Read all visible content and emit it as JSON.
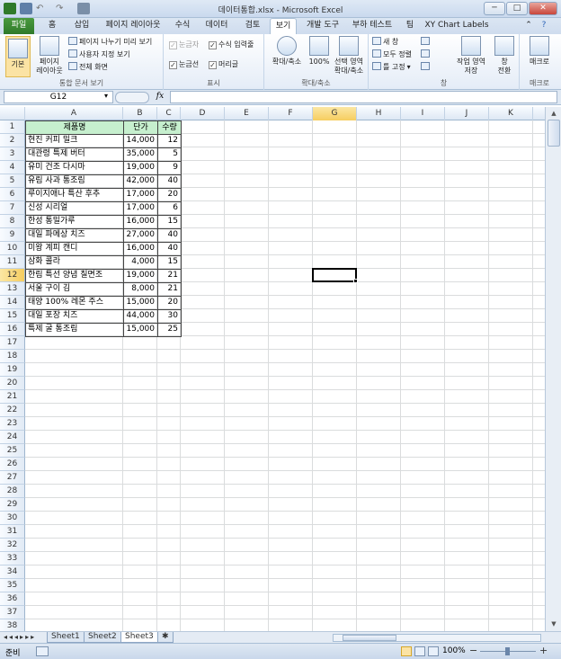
{
  "window": {
    "title": "데이터통합.xlsx - Microsoft Excel",
    "min_label": "─",
    "max_label": "□",
    "close_label": "✕"
  },
  "tabs": [
    "파일",
    "홈",
    "삽입",
    "페이지 레이아웃",
    "수식",
    "데이터",
    "검토",
    "보기",
    "개발 도구",
    "부하 테스트",
    "팀",
    "XY Chart Labels"
  ],
  "active_tab": "보기",
  "ribbon": {
    "group_workbook_views": {
      "label": "통합 문서 보기",
      "normal": "기본",
      "page_layout_1": "페이지",
      "page_layout_2": "레이아웃",
      "page_break_preview": "페이지 나누기 미리 보기",
      "custom_views": "사용자 지정 보기",
      "full_screen": "전체 화면"
    },
    "group_show": {
      "label": "표시",
      "ruler": "눈금자",
      "formula_bar": "수식 입력줄",
      "gridlines": "눈금선",
      "headings": "머리글"
    },
    "group_zoom": {
      "label": "확대/축소",
      "zoom": "확대/축소",
      "zoom100": "100%",
      "zoom_sel_1": "선택 영역",
      "zoom_sel_2": "확대/축소"
    },
    "group_window": {
      "label": "창",
      "new_window": "새 창",
      "arrange_all": "모두 정렬",
      "freeze_panes": "틀 고정",
      "save_ws_1": "작업 영역",
      "save_ws_2": "저장",
      "switch_1": "창",
      "switch_2": "전환"
    },
    "group_macros": {
      "label": "매크로",
      "macros": "매크로"
    }
  },
  "formula_bar": {
    "name_box": "G12",
    "fx": "fx",
    "value": ""
  },
  "columns": [
    "A",
    "B",
    "C",
    "D",
    "E",
    "F",
    "G",
    "H",
    "I",
    "J",
    "K"
  ],
  "selected_column": "G",
  "selected_row": 12,
  "rows": [
    "1",
    "2",
    "3",
    "4",
    "5",
    "6",
    "7",
    "8",
    "9",
    "10",
    "11",
    "12",
    "13",
    "14",
    "15",
    "16",
    "17",
    "18",
    "19",
    "20",
    "21",
    "22",
    "23",
    "24",
    "25",
    "26",
    "27",
    "28",
    "29",
    "30",
    "31",
    "32",
    "33",
    "34",
    "35",
    "36",
    "37",
    "38"
  ],
  "table": {
    "headers": [
      "제품명",
      "단가",
      "수량"
    ],
    "data": [
      [
        "현진 커피 밀크",
        "14,000",
        "12"
      ],
      [
        "대관령 특제 버터",
        "35,000",
        "5"
      ],
      [
        "유미 건조 다시마",
        "19,000",
        "9"
      ],
      [
        "유림 사과 통조림",
        "42,000",
        "40"
      ],
      [
        "루이지애나 특산 후추",
        "17,000",
        "20"
      ],
      [
        "신성 시리얼",
        "17,000",
        "6"
      ],
      [
        "한성 통밀가루",
        "16,000",
        "15"
      ],
      [
        "대일 파메상 치즈",
        "27,000",
        "40"
      ],
      [
        "미왕 계피 캔디",
        "16,000",
        "40"
      ],
      [
        "삼화 콜라",
        "4,000",
        "15"
      ],
      [
        "한림 특선 양념 칠면조",
        "19,000",
        "21"
      ],
      [
        "서울 구이 김",
        "8,000",
        "21"
      ],
      [
        "태양 100% 레몬 주스",
        "15,000",
        "20"
      ],
      [
        "대일 포장 치즈",
        "44,000",
        "30"
      ],
      [
        "특제 굴 통조림",
        "15,000",
        "25"
      ]
    ]
  },
  "sheets": [
    "Sheet1",
    "Sheet2",
    "Sheet3"
  ],
  "active_sheet": "Sheet3",
  "status": {
    "ready": "준비",
    "zoom": "100%",
    "zoom_minus": "−",
    "zoom_plus": "+"
  }
}
